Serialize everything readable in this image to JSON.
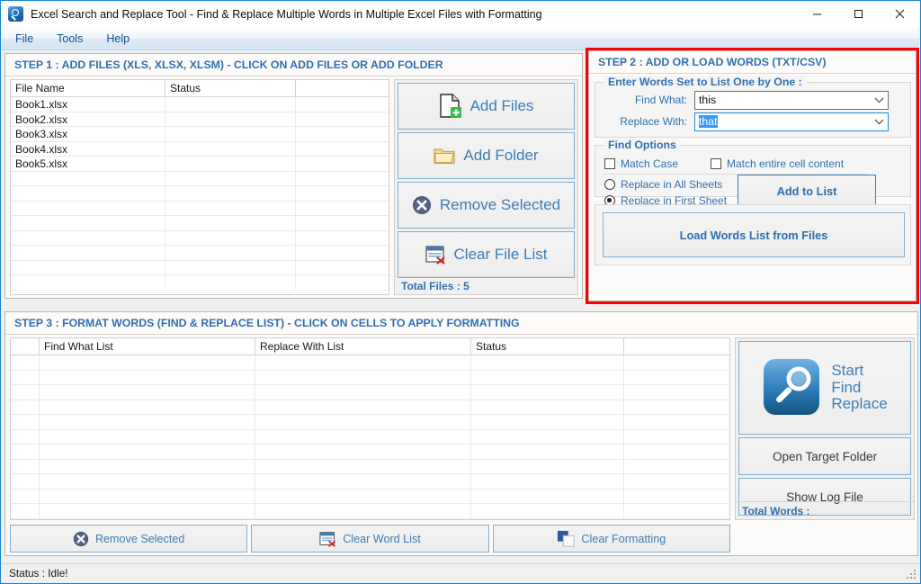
{
  "window": {
    "title": "Excel Search and Replace Tool - Find & Replace Multiple Words in Multiple Excel Files with Formatting",
    "app_icon": "magnifier-icon",
    "controls": {
      "minimize": "minimize",
      "maximize": "maximize",
      "close": "close"
    }
  },
  "menu": {
    "items": [
      "File",
      "Tools",
      "Help"
    ]
  },
  "step1": {
    "title": "STEP 1 : ADD FILES (XLS, XLSX, XLSM) - CLICK ON ADD FILES OR ADD FOLDER",
    "columns": [
      "File Name",
      "Status",
      ""
    ],
    "rows": [
      [
        "Book1.xlsx",
        "",
        ""
      ],
      [
        "Book2.xlsx",
        "",
        ""
      ],
      [
        "Book3.xlsx",
        "",
        ""
      ],
      [
        "Book4.xlsx",
        "",
        ""
      ],
      [
        "Book5.xlsx",
        "",
        ""
      ]
    ],
    "empty_rows": 8,
    "buttons": [
      {
        "label": "Add Files",
        "icon": "file-add-icon"
      },
      {
        "label": "Add Folder",
        "icon": "folder-icon"
      },
      {
        "label": "Remove Selected",
        "icon": "remove-circle-icon"
      },
      {
        "label": "Clear File List",
        "icon": "clear-list-icon"
      }
    ],
    "total_files": "Total Files : 5"
  },
  "step2": {
    "title": "STEP 2 : ADD OR LOAD WORDS (TXT/CSV)",
    "highlight_color": "#ff0000",
    "enter_group": {
      "title": "Enter Words Set to List One by One :",
      "find_what_label": "Find What:",
      "find_what_value": "this",
      "replace_with_label": "Replace With:",
      "replace_with_value": "that"
    },
    "find_options": {
      "title": "Find Options",
      "match_case": {
        "label": "Match Case",
        "checked": false
      },
      "match_entire": {
        "label": "Match entire cell content",
        "checked": false
      },
      "replace_all_sheets": {
        "label": "Replace in All Sheets",
        "selected": false
      },
      "replace_first_sheet": {
        "label": "Replace in First Sheet",
        "selected": true
      },
      "add_to_list": "Add to List"
    },
    "load_button": "Load Words List from Files"
  },
  "step3": {
    "title": "STEP 3 : FORMAT WORDS (FIND & REPLACE LIST) - CLICK ON CELLS TO APPLY FORMATTING",
    "columns": [
      "",
      "Find What List",
      "Replace With List",
      "Status",
      ""
    ],
    "rows": [],
    "empty_rows": 10,
    "buttons": [
      {
        "label": "Start\nFind\nReplace",
        "label_lines": [
          "Start",
          "Find",
          "Replace"
        ],
        "icon": "magnifier-icon"
      },
      {
        "label": "Open Target Folder",
        "icon": ""
      },
      {
        "label": "Show Log File",
        "icon": ""
      }
    ],
    "total_words": "Total Words :",
    "bottom_buttons": [
      {
        "label": "Remove Selected",
        "icon": "remove-circle-icon"
      },
      {
        "label": "Clear Word List",
        "icon": "clear-list-icon"
      },
      {
        "label": "Clear Formatting",
        "icon": "clear-format-icon"
      }
    ]
  },
  "statusbar": {
    "text": "Status :  Idle!"
  },
  "colors": {
    "accent_blue": "#2f6fb0",
    "border_blue": "#83aecd",
    "highlight_red": "#ff0000",
    "selection_blue": "#3399ff",
    "window_border": "#1884d6"
  }
}
